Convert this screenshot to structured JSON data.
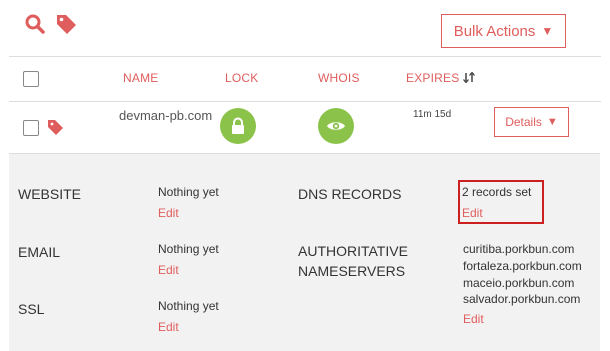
{
  "toolbar": {
    "search_icon": "search-icon",
    "tag_icon": "tag-icon",
    "bulk_actions_label": "Bulk Actions",
    "bulk_caret": "▼"
  },
  "table": {
    "columns": {
      "name": "NAME",
      "lock": "LOCK",
      "whois": "WHOIS",
      "expires": "EXPIRES"
    },
    "row": {
      "domain": "devman-pb.com",
      "expires": "11m 15d",
      "details_label": "Details",
      "details_caret": "▼"
    }
  },
  "details": {
    "website": {
      "label": "WEBSITE",
      "value": "Nothing yet",
      "edit": "Edit"
    },
    "email": {
      "label": "EMAIL",
      "value": "Nothing yet",
      "edit": "Edit"
    },
    "ssl": {
      "label": "SSL",
      "value": "Nothing yet",
      "edit": "Edit"
    },
    "dns": {
      "label": "DNS RECORDS",
      "value": "2 records set",
      "edit": "Edit"
    },
    "nameservers": {
      "label_line1": "AUTHORITATIVE",
      "label_line2": "NAMESERVERS",
      "servers": [
        "curitiba.porkbun.com",
        "fortaleza.porkbun.com",
        "maceio.porkbun.com",
        "salvador.porkbun.com"
      ],
      "edit": "Edit"
    }
  },
  "colors": {
    "accent": "#e05d5d",
    "green": "#8bc34a",
    "highlight": "#cc1f1f",
    "panel": "#f2f2f2"
  }
}
